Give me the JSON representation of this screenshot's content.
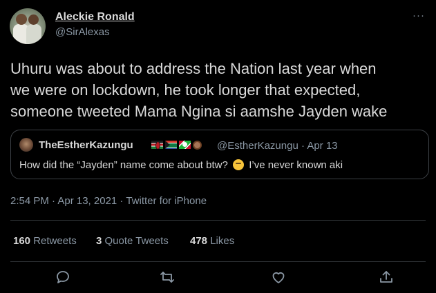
{
  "author": {
    "display_name": "Aleckie Ronald",
    "handle": "@SirAlexas"
  },
  "more_label": "···",
  "tweet": {
    "text": "Uhuru was about to address the Nation last year when\nwe were on lockdown, he took longer that expected,\nsomeone tweeted Mama Ngina si aamshe Jayden wake"
  },
  "quote": {
    "display_name": "TheEstherKazungu",
    "handle": "@EstherKazungu",
    "separator": "·",
    "date": "Apr 13",
    "text_before": "How did the “Jayden” name come about btw?",
    "text_after": "I’ve never known aki"
  },
  "meta": {
    "timestamp": "2:54 PM · Apr 13, 2021 · Twitter for iPhone"
  },
  "stats": {
    "retweets_count": "160",
    "retweets_label": "Retweets",
    "quotes_count": "3",
    "quotes_label": "Quote Tweets",
    "likes_count": "478",
    "likes_label": "Likes"
  },
  "actions": [
    {
      "icon": "reply-icon"
    },
    {
      "icon": "retweet-icon"
    },
    {
      "icon": "like-icon"
    },
    {
      "icon": "share-icon"
    }
  ],
  "colors": {
    "background": "#000000",
    "text": "#d9d9d9",
    "muted": "#8b98a5",
    "border": "#2f3336"
  }
}
